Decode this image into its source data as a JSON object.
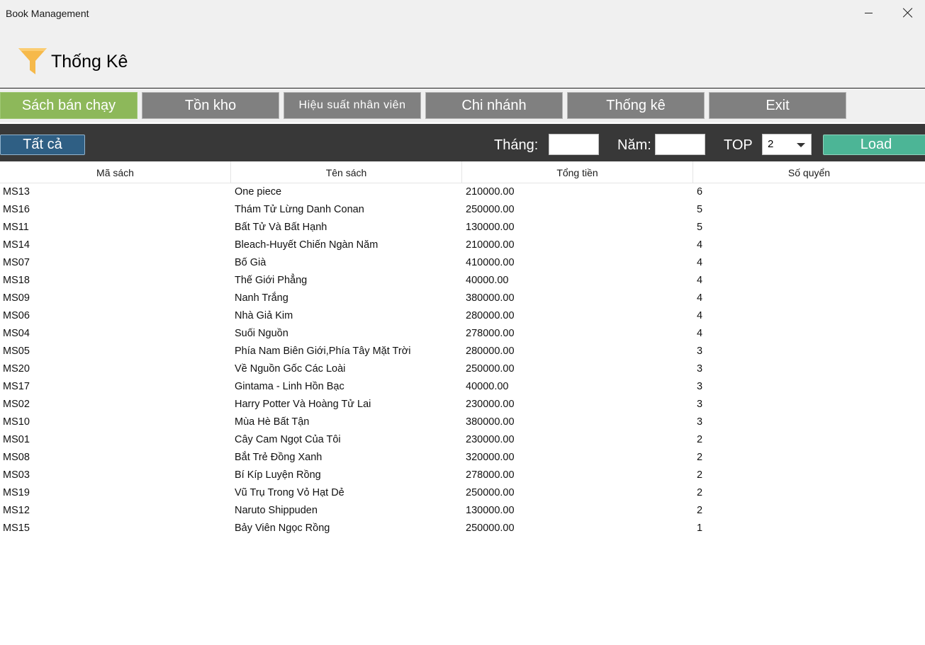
{
  "window": {
    "title": "Book Management"
  },
  "header": {
    "title": "Thống Kê",
    "icon": "funnel-icon"
  },
  "tabs": [
    {
      "label": "Sách bán chạy",
      "active": true
    },
    {
      "label": "Tồn kho",
      "active": false
    },
    {
      "label": "Hiệu suất nhân viên",
      "active": false
    },
    {
      "label": "Chi nhánh",
      "active": false
    },
    {
      "label": "Thống kê",
      "active": false
    },
    {
      "label": "Exit",
      "active": false
    }
  ],
  "filter": {
    "all_label": "Tất cả",
    "month_label": "Tháng:",
    "month_value": "",
    "year_label": "Năm:",
    "year_value": "",
    "top_label": "TOP",
    "top_value": "2",
    "load_label": "Load"
  },
  "colors": {
    "active_tab": "#8db85a",
    "tab": "#808080",
    "filter_bar": "#383838",
    "all_button": "#2f5f84",
    "load_button": "#4cb596"
  },
  "table": {
    "columns": [
      "Mã sách",
      "Tên sách",
      "Tổng tiền",
      "Số quyển"
    ],
    "rows": [
      [
        "MS13",
        "One piece",
        "210000.00",
        "6"
      ],
      [
        "MS16",
        "Thám Tử Lừng Danh Conan",
        "250000.00",
        "5"
      ],
      [
        "MS11",
        "Bất Tử Và Bất Hạnh",
        "130000.00",
        "5"
      ],
      [
        "MS14",
        "Bleach-Huyết Chiến Ngàn Năm",
        "210000.00",
        "4"
      ],
      [
        "MS07",
        "Bố Già",
        "410000.00",
        "4"
      ],
      [
        "MS18",
        "Thế Giới Phẳng",
        "40000.00",
        "4"
      ],
      [
        "MS09",
        "Nanh Trắng",
        "380000.00",
        "4"
      ],
      [
        "MS06",
        "Nhà Giả Kim",
        "280000.00",
        "4"
      ],
      [
        "MS04",
        "Suối Nguồn",
        "278000.00",
        "4"
      ],
      [
        "MS05",
        "Phía Nam Biên Giới,Phía Tây Mặt Trời",
        "280000.00",
        "3"
      ],
      [
        "MS20",
        "Về Nguồn Gốc Các Loài",
        "250000.00",
        "3"
      ],
      [
        "MS17",
        "Gintama - Linh Hồn Bạc",
        "40000.00",
        "3"
      ],
      [
        "MS02",
        "Harry Potter Và Hoàng Tử Lai",
        "230000.00",
        "3"
      ],
      [
        "MS10",
        "Mùa Hè Bất Tận",
        "380000.00",
        "3"
      ],
      [
        "MS01",
        "Cây Cam Ngọt Của Tôi",
        "230000.00",
        "2"
      ],
      [
        "MS08",
        "Bắt Trẻ Đồng Xanh",
        "320000.00",
        "2"
      ],
      [
        "MS03",
        "Bí Kíp Luyện Rồng",
        "278000.00",
        "2"
      ],
      [
        "MS19",
        "Vũ Trụ Trong Vỏ Hạt Dẻ",
        "250000.00",
        "2"
      ],
      [
        "MS12",
        "Naruto Shippuden",
        "130000.00",
        "2"
      ],
      [
        "MS15",
        "Bảy Viên Ngọc Rồng",
        "250000.00",
        "1"
      ]
    ]
  }
}
